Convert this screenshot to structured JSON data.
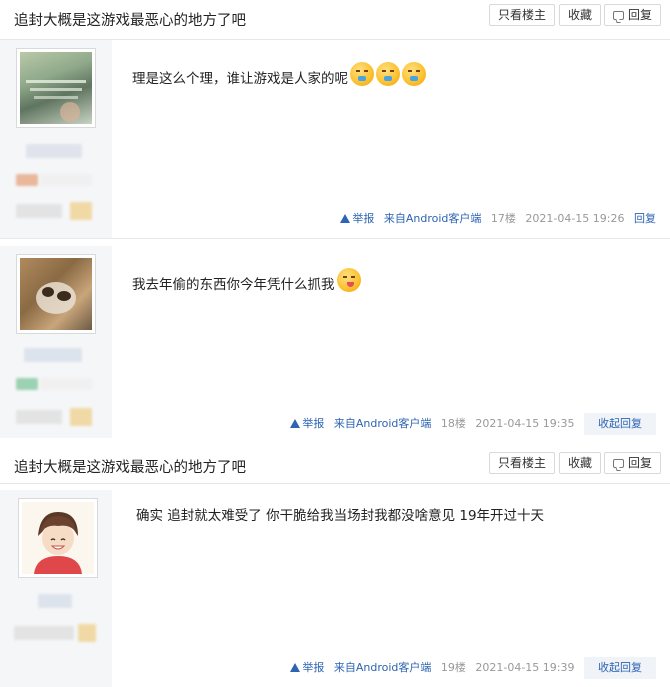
{
  "thread": {
    "title": "追封大概是这游戏最恶心的地方了吧",
    "only_op_label": "只看楼主",
    "favorite_label": "收藏",
    "reply_label": "回复"
  },
  "posts": [
    {
      "text": "理是这么个理，谁让游戏是人家的呢",
      "emojis": [
        "annoyed-emoji",
        "annoyed-emoji",
        "annoyed-emoji"
      ],
      "report_label": "举报",
      "client_label": "来自Android客户端",
      "floor": "17楼",
      "time": "2021-04-15 19:26",
      "action_label": "回复"
    },
    {
      "text": "我去年偷的东西你今年凭什么抓我",
      "emojis": [
        "tongue-emoji"
      ],
      "report_label": "举报",
      "client_label": "来自Android客户端",
      "floor": "18楼",
      "time": "2021-04-15 19:35",
      "action_label": "收起回复"
    },
    {
      "text": "确实 追封就太难受了 你干脆给我当场封我都没啥意见 19年开过十天",
      "emojis": [],
      "report_label": "举报",
      "client_label": "来自Android客户端",
      "floor": "19楼",
      "time": "2021-04-15 19:39",
      "action_label": "收起回复"
    }
  ],
  "colors": {
    "link_blue": "#2d64b3",
    "side_bg": "#f5f6f8",
    "meta_gray": "#999999"
  }
}
